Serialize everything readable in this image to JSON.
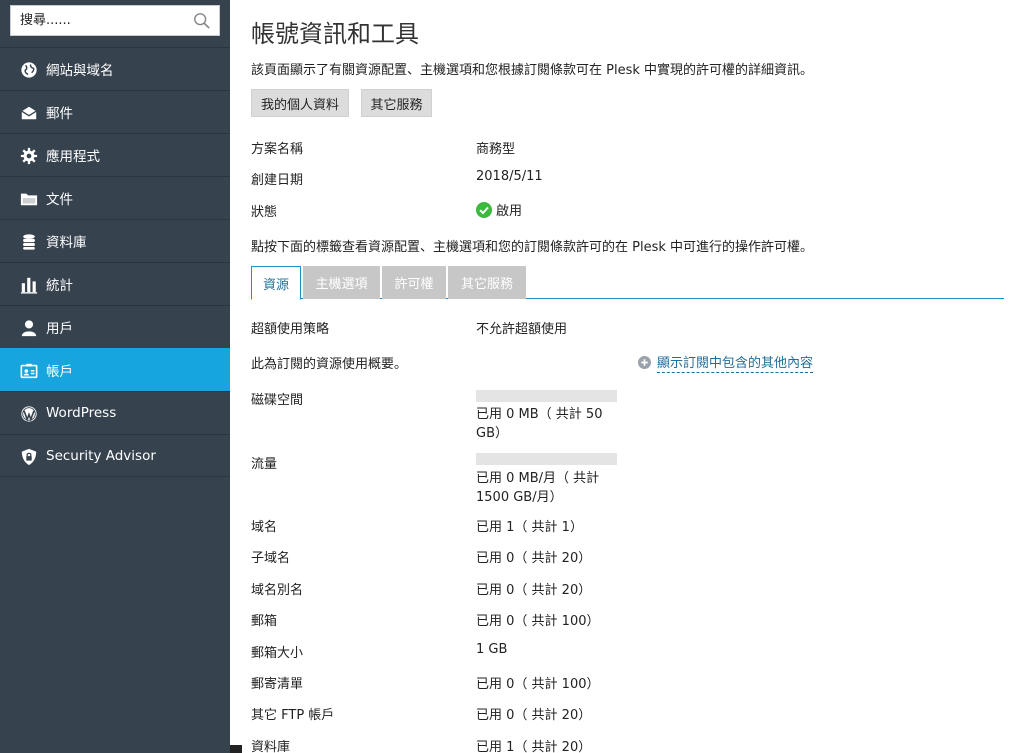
{
  "search": {
    "placeholder": "搜尋......"
  },
  "sidebar": {
    "items": [
      {
        "label": "網站與域名",
        "icon": "globe-icon"
      },
      {
        "label": "郵件",
        "icon": "mail-icon"
      },
      {
        "label": "應用程式",
        "icon": "gear-icon"
      },
      {
        "label": "文件",
        "icon": "folder-icon"
      },
      {
        "label": "資料庫",
        "icon": "database-icon"
      },
      {
        "label": "統計",
        "icon": "bar-chart-icon"
      },
      {
        "label": "用戶",
        "icon": "user-icon"
      },
      {
        "label": "帳戶",
        "icon": "account-icon",
        "active": true
      },
      {
        "label": "WordPress",
        "icon": "wordpress-icon"
      },
      {
        "label": "Security Advisor",
        "icon": "shield-icon"
      }
    ]
  },
  "page": {
    "title": "帳號資訊和工具",
    "intro": "該頁面顯示了有關資源配置、主機選項和您根據訂閱條款可在 Plesk 中實現的許可權的詳細資訊。",
    "buttons": {
      "profile": "我的個人資料",
      "other_services": "其它服務"
    },
    "plan": {
      "name_label": "方案名稱",
      "name_value": "商務型",
      "created_label": "創建日期",
      "created_value": "2018/5/11",
      "status_label": "狀態",
      "status_value": "啟用"
    },
    "tip": "點按下面的標籤查看資源配置、主機選項和您的訂閱條款許可的在 Plesk 中可進行的操作許可權。",
    "tabs": [
      "資源",
      "主機選項",
      "許可權",
      "其它服務"
    ],
    "resources": {
      "overuse_label": "超額使用策略",
      "overuse_value": "不允許超額使用",
      "summary": "此為訂閱的資源使用概要。",
      "show_more": "顯示訂閱中包含的其他內容",
      "disk_label": "磁碟空間",
      "disk_value": "已用 0 MB（ 共計 50 GB）",
      "disk_usage_fraction": 0,
      "traffic_label": "流量",
      "traffic_value": "已用 0 MB/月（ 共計 1500 GB/月）",
      "traffic_usage_fraction": 0,
      "rows": [
        {
          "label": "域名",
          "value": "已用 1（ 共計 1）"
        },
        {
          "label": "子域名",
          "value": "已用 0（ 共計 20）"
        },
        {
          "label": "域名別名",
          "value": "已用 0（ 共計 20）"
        },
        {
          "label": "郵箱",
          "value": "已用 0（ 共計 100）"
        },
        {
          "label": "郵箱大小",
          "value": "1 GB"
        },
        {
          "label": "郵寄清單",
          "value": "已用 0（ 共計 100）"
        },
        {
          "label": "其它 FTP 帳戶",
          "value": "已用 0（ 共計 20）"
        },
        {
          "label": "資料庫",
          "value": "已用 1（ 共計 20）"
        }
      ]
    }
  },
  "colors": {
    "sidebar": "#36424e",
    "active": "#17a5df",
    "link": "#1f6e99",
    "ok": "#3db93d"
  }
}
